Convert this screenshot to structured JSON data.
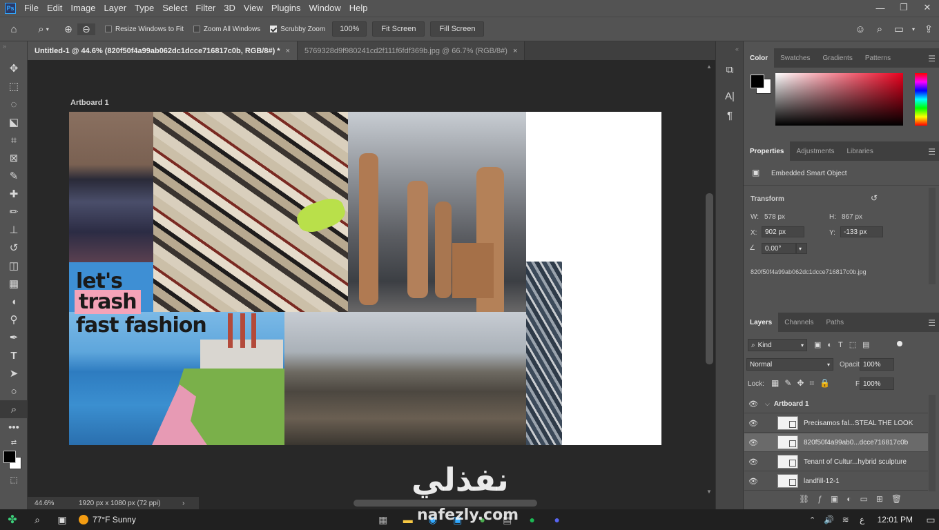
{
  "app": {
    "logo_text": "Ps"
  },
  "menu": [
    "File",
    "Edit",
    "Image",
    "Layer",
    "Type",
    "Select",
    "Filter",
    "3D",
    "View",
    "Plugins",
    "Window",
    "Help"
  ],
  "window_controls": {
    "minimize": "—",
    "restore": "❐",
    "close": "✕"
  },
  "options_bar": {
    "resize_windows": "Resize Windows to Fit",
    "zoom_all": "Zoom All Windows",
    "scrubby_zoom": "Scrubby Zoom",
    "zoom_value": "100%",
    "fit_screen": "Fit Screen",
    "fill_screen": "Fill Screen",
    "checks": {
      "resize": false,
      "zoom_all": false,
      "scrubby": true
    }
  },
  "tabs": [
    {
      "label": "Untitled-1 @ 44.6% (820f50f4a99ab062dc1dcce716817c0b, RGB/8#) *",
      "close": "×"
    },
    {
      "label": "5769328d9f980241cd2f111f6fdf369b.jpg @ 66.7% (RGB/8#)",
      "close": "×"
    }
  ],
  "artboard": {
    "label": "Artboard 1"
  },
  "collage": {
    "line1": "let's",
    "line2": "trash",
    "line3": "fast fashion"
  },
  "status": {
    "zoom": "44.6%",
    "doc_info": "1920 px x 1080 px (72 ppi)",
    "arrow": "›"
  },
  "color_panel": {
    "tabs": [
      "Color",
      "Swatches",
      "Gradients",
      "Patterns"
    ]
  },
  "properties_panel": {
    "tabs": [
      "Properties",
      "Adjustments",
      "Libraries"
    ],
    "object_type": "Embedded Smart Object",
    "transform_title": "Transform",
    "w_label": "W:",
    "w_value": "578 px",
    "h_label": "H:",
    "h_value": "867 px",
    "x_label": "X:",
    "x_value": "902 px",
    "y_label": "Y:",
    "y_value": "-133 px",
    "angle_value": "0.00°",
    "filename": "820f50f4a99ab062dc1dcce716817c0b.jpg"
  },
  "layers_panel": {
    "tabs": [
      "Layers",
      "Channels",
      "Paths"
    ],
    "kind": "Kind",
    "blend_mode": "Normal",
    "opacity_label": "Opacity:",
    "opacity_value": "100%",
    "lock_label": "Lock:",
    "fill_label": "Fill:",
    "fill_value": "100%",
    "group": "Artboard 1",
    "layers": [
      {
        "name": "Precisamos fal...STEAL THE LOOK",
        "selected": false
      },
      {
        "name": "820f50f4a99ab0...dcce716817c0b",
        "selected": true
      },
      {
        "name": "Tenant of Cultur...hybrid sculpture",
        "selected": false
      },
      {
        "name": "landfill-12-1",
        "selected": false
      }
    ]
  },
  "taskbar": {
    "weather": "77°F Sunny",
    "time": "12:01 PM",
    "lang": "ع"
  },
  "watermark": {
    "arabic": "نفذلي",
    "latin": "nafezly.com"
  },
  "colors": {
    "accent": "#31a8ff",
    "pink": "#f4a3b8",
    "sky": "#3a8ccc"
  }
}
